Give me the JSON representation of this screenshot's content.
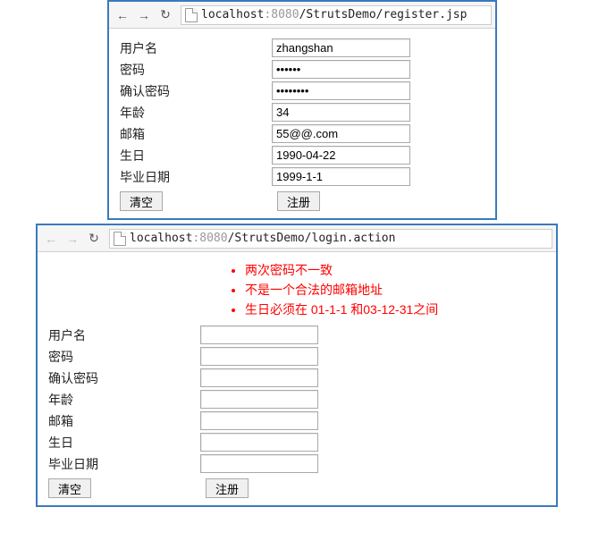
{
  "window1": {
    "url_host": "localhost",
    "url_port": ":8080",
    "url_path": "/StrutsDemo/register.jsp",
    "fields": [
      {
        "label": "用户名",
        "value": "zhangshan",
        "type": "text"
      },
      {
        "label": "密码",
        "value": "••••••",
        "type": "text"
      },
      {
        "label": "确认密码",
        "value": "••••••••",
        "type": "text"
      },
      {
        "label": "年龄",
        "value": "34",
        "type": "text"
      },
      {
        "label": "邮箱",
        "value": "55@@.com",
        "type": "text"
      },
      {
        "label": "生日",
        "value": "1990-04-22",
        "type": "text"
      },
      {
        "label": "毕业日期",
        "value": "1999-1-1",
        "type": "text"
      }
    ],
    "reset_btn": "清空",
    "submit_btn": "注册"
  },
  "window2": {
    "url_host": "localhost",
    "url_port": ":8080",
    "url_path": "/StrutsDemo/login.action",
    "errors": [
      "两次密码不一致",
      "不是一个合法的邮箱地址",
      "生日必须在 01-1-1 和03-12-31之间"
    ],
    "fields": [
      {
        "label": "用户名",
        "value": "",
        "type": "text"
      },
      {
        "label": "密码",
        "value": "",
        "type": "text"
      },
      {
        "label": "确认密码",
        "value": "",
        "type": "text"
      },
      {
        "label": "年龄",
        "value": "",
        "type": "text"
      },
      {
        "label": "邮箱",
        "value": "",
        "type": "text"
      },
      {
        "label": "生日",
        "value": "",
        "type": "text"
      },
      {
        "label": "毕业日期",
        "value": "",
        "type": "text"
      }
    ],
    "reset_btn": "清空",
    "submit_btn": "注册"
  }
}
